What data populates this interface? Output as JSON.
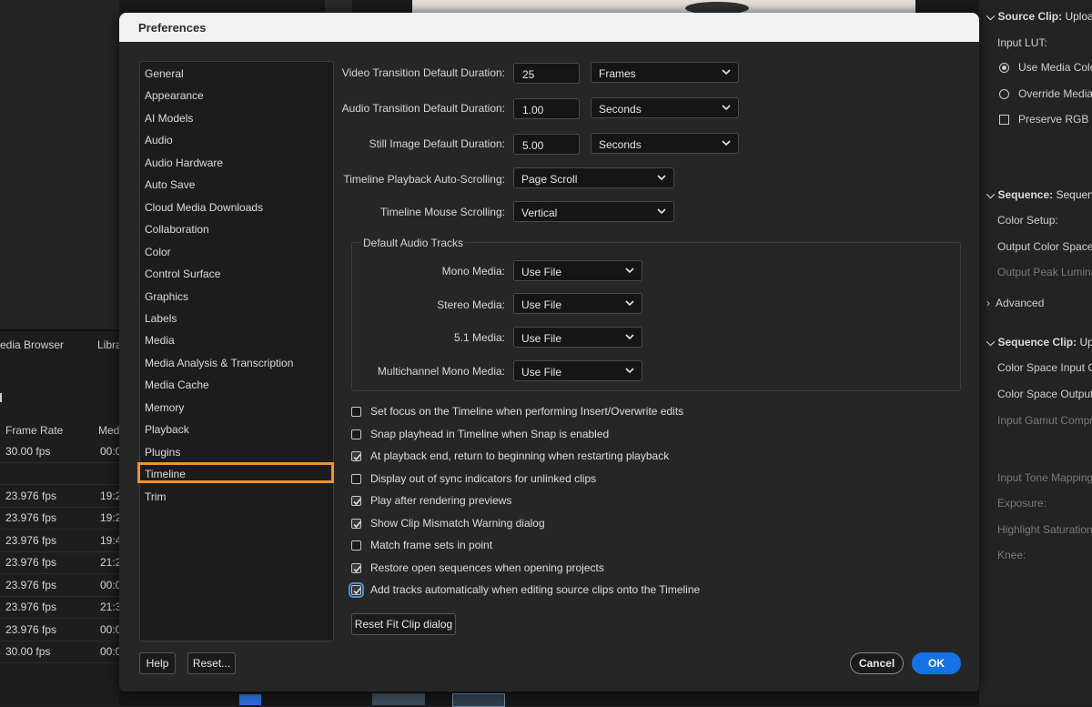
{
  "background": {
    "left_tabs": [
      "edia Browser",
      "Libra"
    ],
    "left_headers": [
      "Frame Rate",
      "Med"
    ],
    "left_rows": [
      {
        "rate": "30.00 fps",
        "media": "00:0"
      },
      {
        "rate": "",
        "media": ""
      },
      {
        "rate": "23.976 fps",
        "media": "19:2"
      },
      {
        "rate": "23.976 fps",
        "media": "19:2"
      },
      {
        "rate": "23.976 fps",
        "media": "19:4"
      },
      {
        "rate": "23.976 fps",
        "media": "21:2"
      },
      {
        "rate": "23.976 fps",
        "media": "00:0"
      },
      {
        "rate": "23.976 fps",
        "media": "21:3"
      },
      {
        "rate": "23.976 fps",
        "media": "00:0"
      },
      {
        "rate": "30.00 fps",
        "media": "00:0"
      }
    ],
    "right_panel": {
      "source_clip": "Source Clip:",
      "source_clip_value": "Upload",
      "input_lut": "Input LUT:",
      "use_media": "Use Media Color",
      "override_media": "Override Media C",
      "preserve_rgb": "Preserve RGB (di",
      "sequence": "Sequence:",
      "sequence_value": "Sequence",
      "color_setup": "Color Setup:",
      "output_color_space": "Output Color Space:",
      "output_peak": "Output Peak Luminan",
      "advanced": "Advanced",
      "sequence_clip": "Sequence Clip:",
      "sequence_clip_value": "Uplo",
      "cs_input": "Color Space Input Co",
      "cs_output": "Color Space Output C",
      "input_gamut": "Input Gamut Compre",
      "input_tone": "Input Tone Mapping:",
      "exposure": "Exposure:",
      "highlight_sat": "Highlight Saturation:",
      "knee": "Knee:"
    }
  },
  "dialog": {
    "title": "Preferences",
    "nav_items": [
      "General",
      "Appearance",
      "AI Models",
      "Audio",
      "Audio Hardware",
      "Auto Save",
      "Cloud Media Downloads",
      "Collaboration",
      "Color",
      "Control Surface",
      "Graphics",
      "Labels",
      "Media",
      "Media Analysis & Transcription",
      "Media Cache",
      "Memory",
      "Playback",
      "Plugins",
      "Timeline",
      "Trim"
    ],
    "selected_nav": "Timeline",
    "video_transition": {
      "label": "Video Transition Default Duration:",
      "value": "25",
      "unit": "Frames"
    },
    "audio_transition": {
      "label": "Audio Transition Default Duration:",
      "value": "1.00",
      "unit": "Seconds"
    },
    "still_image": {
      "label": "Still Image Default Duration:",
      "value": "5.00",
      "unit": "Seconds"
    },
    "auto_scrolling": {
      "label": "Timeline Playback Auto-Scrolling:",
      "value": "Page Scroll"
    },
    "mouse_scrolling": {
      "label": "Timeline Mouse Scrolling:",
      "value": "Vertical"
    },
    "audio_tracks": {
      "legend": "Default Audio Tracks",
      "mono": {
        "label": "Mono Media:",
        "value": "Use File"
      },
      "stereo": {
        "label": "Stereo Media:",
        "value": "Use File"
      },
      "five_one": {
        "label": "5.1 Media:",
        "value": "Use File"
      },
      "multichannel": {
        "label": "Multichannel Mono Media:",
        "value": "Use File"
      }
    },
    "checkboxes": [
      {
        "label": "Set focus on the Timeline when performing Insert/Overwrite edits",
        "checked": false
      },
      {
        "label": "Snap playhead in Timeline when Snap is enabled",
        "checked": false
      },
      {
        "label": "At playback end, return to beginning when restarting playback",
        "checked": true
      },
      {
        "label": "Display out of sync indicators for unlinked clips",
        "checked": false
      },
      {
        "label": "Play after rendering previews",
        "checked": true
      },
      {
        "label": "Show Clip Mismatch Warning dialog",
        "checked": true
      },
      {
        "label": "Match frame sets in point",
        "checked": false
      },
      {
        "label": "Restore open sequences when opening projects",
        "checked": true
      },
      {
        "label": "Add tracks automatically when editing source clips onto the Timeline",
        "checked": true
      }
    ],
    "reset_fit_clip": "Reset Fit Clip dialog",
    "help": "Help",
    "reset": "Reset...",
    "cancel": "Cancel",
    "ok": "OK"
  }
}
